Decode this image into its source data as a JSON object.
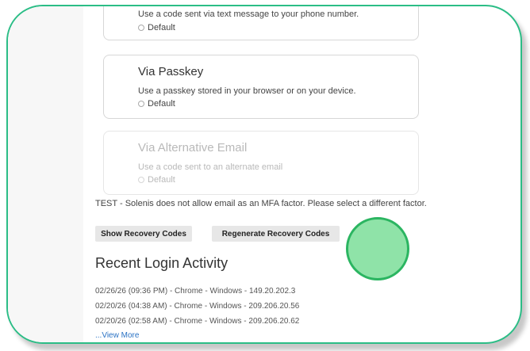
{
  "mfa_options": {
    "sms": {
      "description": "Use a code sent via text message to your phone number.",
      "default_label": "Default"
    },
    "passkey": {
      "title": "Via Passkey",
      "description": "Use a passkey stored in your browser or on your device.",
      "default_label": "Default"
    },
    "alt_email": {
      "title": "Via Alternative Email",
      "description": "Use a code sent to an alternate email",
      "default_label": "Default"
    }
  },
  "warning_text": "TEST - Solenis does not allow email as an MFA factor. Please select a different factor.",
  "buttons": {
    "show_recovery": "Show Recovery Codes",
    "regenerate_recovery": "Regenerate Recovery Codes"
  },
  "recent_login": {
    "title": "Recent Login Activity",
    "entries": [
      "02/26/26 (09:36 PM) - Chrome - Windows - 149.20.202.3",
      "02/20/26 (04:38 AM) - Chrome - Windows - 209.206.20.56",
      "02/20/26 (02:58 AM) - Chrome - Windows - 209.206.20.62"
    ],
    "view_more": "...View More"
  },
  "colors": {
    "frame_border": "#2bbd86",
    "touch_indicator": "#8fe3a8",
    "link": "#2a72c4"
  }
}
